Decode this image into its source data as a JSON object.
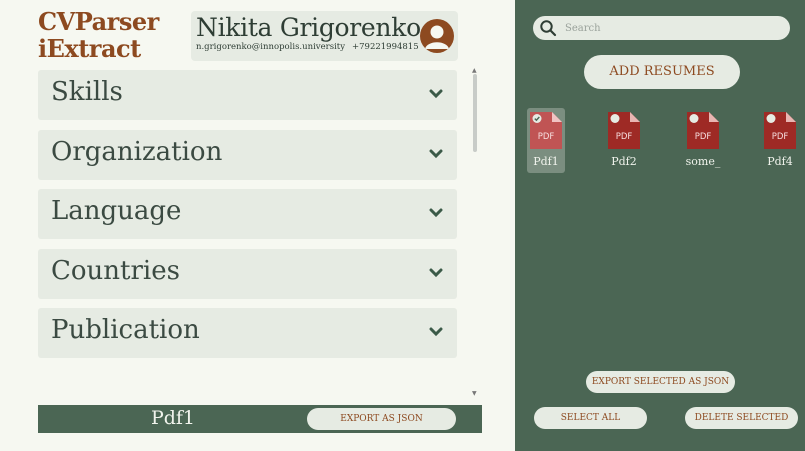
{
  "logo": {
    "line1": "CVParser",
    "line2": "iExtract"
  },
  "profile": {
    "name": "Nikita Grigorenko",
    "email": "n.grigorenko@innopolis.university",
    "phone": "+79221994815",
    "avatar_icon": "user-avatar-icon"
  },
  "sections": [
    {
      "label": "Skills"
    },
    {
      "label": "Organization"
    },
    {
      "label": "Language"
    },
    {
      "label": "Countries"
    },
    {
      "label": "Publication"
    }
  ],
  "current_file": {
    "name": "Pdf1",
    "export_label": "EXPORT AS JSON"
  },
  "search": {
    "placeholder": "Search",
    "value": ""
  },
  "add_resumes_label": "ADD RESUMES",
  "files": [
    {
      "label": "Pdf1",
      "badge": "PDF",
      "selected": true
    },
    {
      "label": "Pdf2",
      "badge": "PDF",
      "selected": false
    },
    {
      "label": "some_",
      "badge": "PDF",
      "selected": false
    },
    {
      "label": "Pdf4",
      "badge": "PDF",
      "selected": false
    }
  ],
  "actions": {
    "export_selected": "EXPORT SELECTED AS JSON",
    "select_all": "SELECT ALL",
    "delete_selected": "DELETE SELECTED"
  },
  "colors": {
    "brand_brown": "#8d4a20",
    "panel_green": "#4b6654",
    "pill_bg": "#e6ebe3",
    "pdf_red": "#9e2a25"
  }
}
